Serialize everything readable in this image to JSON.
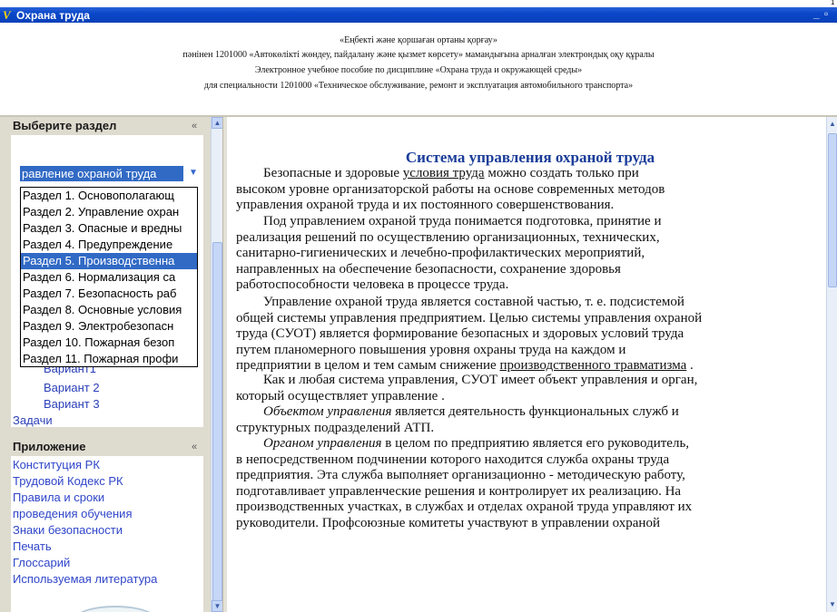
{
  "window": {
    "title": "Охрана труда",
    "app_icon_glyph": "V",
    "minimize_glyph": "_",
    "maximize_glyph": "▫",
    "corner_mark": "1"
  },
  "header": {
    "line1": "«Еңбекті және қоршаған ортаны қорғау»",
    "line2": "пәнінен 1201000 «Автокөлікті жөндеу, пайдалану және қызмет көрсету» мамандығына арналған электрондық оқу құралы",
    "line3": "Электронное учебное пособие по дисциплине «Охрана труда и окружающей среды»",
    "line4": "для специальности 1201000 «Техническое обслуживание, ремонт и эксплуатация автомобильного транспорта»"
  },
  "sidebar": {
    "section_panel": {
      "title": "Выберите раздел",
      "collapse_glyph": "«",
      "selected_value": "равление охраной труда",
      "dropdown_arrow": "▼",
      "options": [
        "Раздел 1. Основополагающ",
        "Раздел 2. Управление охран",
        "Раздел 3. Опасные и вредны",
        "Раздел 4. Предупреждение",
        "Раздел 5. Производственна",
        "Раздел 6. Нормализация са",
        "Раздел 7. Безопасность раб",
        "Раздел 8. Основные условия",
        "Раздел 9. Электробезопасн",
        "Раздел 10. Пожарная безоп",
        "Раздел 11. Пожарная профи"
      ],
      "active_option_index": 4,
      "under_items": [
        "Вариант1",
        "Вариант 2",
        "Вариант 3",
        "Задачи"
      ]
    },
    "appendix_panel": {
      "title": "Приложение",
      "collapse_glyph": "«",
      "links": [
        "Конституция РК",
        "Трудовой Кодекс РК",
        "Правила и сроки",
        "проведения обучения",
        "Знаки безопасности",
        "Печать",
        "Глоссарий",
        "Используемая литература"
      ]
    }
  },
  "scroll": {
    "up_glyph": "▲",
    "down_glyph": "▼"
  },
  "main": {
    "title": "Система управления охраной труда",
    "p1": [
      {
        "segments": [
          {
            "t": "Безопасные и здоровые "
          },
          {
            "t": "условия труда",
            "u": true
          },
          {
            "t": " можно создать только при"
          }
        ]
      },
      {
        "segments": [
          {
            "t": "высоком уровне организаторской работы на основе современных методов"
          }
        ]
      },
      {
        "segments": [
          {
            "t": "управления охраной труда и их постоянного совершенствования."
          }
        ]
      }
    ],
    "p2": [
      "Под управлением охраной труда понимается подготовка, принятие и",
      "реализация решений по осуществлению организационных, технических,",
      "санитарно-гигиенических и лечебно-профилактических мероприятий,",
      "направленных на обеспечение безопасности, сохранение здоровья",
      "работоспособности человека в процессе труда."
    ],
    "p3": [
      "Управление охраной труда является составной частью, т. е. подсистемой",
      "общей системы управления предприятием. Целью системы управления охраной",
      "труда (СУОТ) является формирование безопасных и здоровых условий труда",
      "путем планомерного повышения уровня охраны труда на каждом и"
    ],
    "p3_last": {
      "before": "предприятии в целом и тем самым снижение ",
      "link": "производственного травматизма",
      "after": " ."
    },
    "p4": [
      "Как и любая система управления, СУОТ имеет объект управления и орган,",
      "который осуществляет управление ."
    ],
    "p5": {
      "italic": "Объектом управления",
      "rest1": " является деятельность функциональных служб и",
      "line2": "структурных подразделений АТП."
    },
    "p6": {
      "italic": "Органом управления",
      "rest1": " в целом по предприятию является его руководитель,",
      "lines": [
        "в непосредственном подчинении которого находится служба охраны труда",
        "предприятия. Эта служба выполняет организационно - методическую работу,",
        "подготавливает управленческие решения и контролирует их реализацию. На",
        "производственных участках, в службах и отделах охраной труда управляют их",
        "руководители. Профсоюзные комитеты участвуют в управлении охраной"
      ]
    }
  }
}
